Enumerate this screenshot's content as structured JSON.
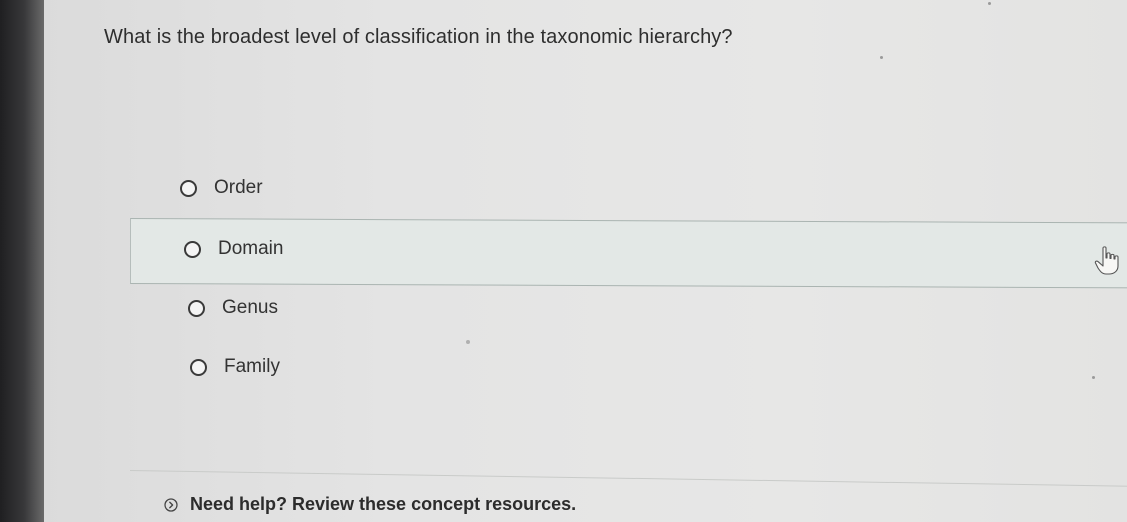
{
  "question": {
    "text": "What is the broadest level of classification in the taxonomic hierarchy?"
  },
  "options": [
    {
      "label": "Order",
      "selected": false
    },
    {
      "label": "Domain",
      "selected": false,
      "hovered": true
    },
    {
      "label": "Genus",
      "selected": false
    },
    {
      "label": "Family",
      "selected": false
    }
  ],
  "help": {
    "label": "Need help? Review these concept resources.",
    "icon": "chevron-right-circle-icon"
  },
  "colors": {
    "hover_background": "#e3e8e6",
    "text": "#2f2f2f"
  }
}
